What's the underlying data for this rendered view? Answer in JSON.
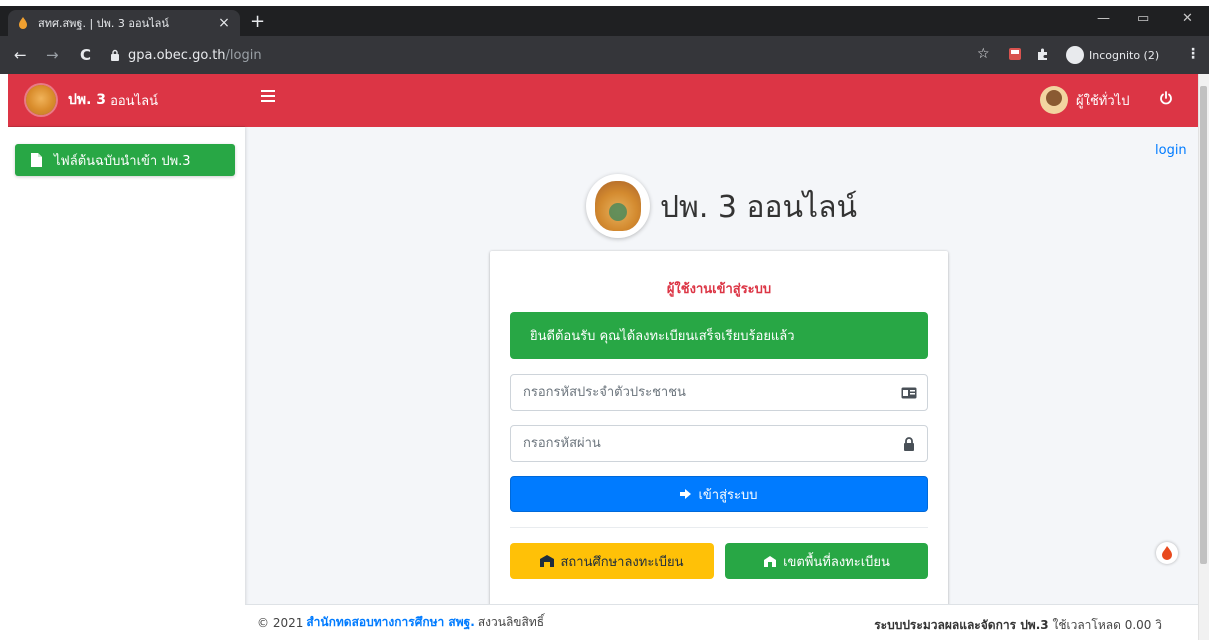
{
  "browser": {
    "tab_title": "สทศ.สพฐ. | ปพ. 3 ออนไลน์",
    "tab_close": "×",
    "new_tab": "+",
    "url_host": "gpa.obec.go.th",
    "url_path": "/login",
    "incognito_label": "Incognito (2)",
    "back_icon": "←",
    "forward_icon": "→",
    "reload_icon": "C",
    "star_icon": "☆",
    "menu_icon": "⋮",
    "minimize": "—",
    "restore": "▭",
    "close": "✕"
  },
  "navbar": {
    "brand_bold": "ปพ. 3",
    "brand_rest": "ออนไลน์",
    "user_label": "ผู้ใช้ทั่วไป"
  },
  "sidebar": {
    "items": [
      {
        "label": "ไฟล์ต้นฉบับนำเข้า ปพ.3",
        "icon": "file-icon"
      }
    ]
  },
  "main": {
    "login_link": "login",
    "page_title": "ปพ. 3 ออนไลน์",
    "card_title": "ผู้ใช้งานเข้าสู่ระบบ",
    "alert_text": "ยินดีต้อนรับ คุณได้ลงทะเบียนเสร็จเรียบร้อยแล้ว",
    "id_placeholder": "กรอกรหัสประจำตัวประชาชน",
    "password_placeholder": "กรอกรหัสผ่าน",
    "login_button": "เข้าสู่ระบบ",
    "school_register_button": "สถานศึกษาลงทะเบียน",
    "area_register_button": "เขตพื้นที่ลงทะเบียน"
  },
  "footer": {
    "copyright": "© 2021",
    "org_link": "สำนักทดสอบทางการศึกษา สพฐ.",
    "rights": "สงวนลิขสิทธิ์",
    "right_bold": "ระบบประมวลผลและจัดการ ปพ.3",
    "right_rest": "ใช้เวลาโหลด 0.00 วิ"
  },
  "colors": {
    "navbar": "#dc3545",
    "sidebar_item": "#28a745",
    "primary": "#007bff",
    "warning": "#ffc107"
  }
}
